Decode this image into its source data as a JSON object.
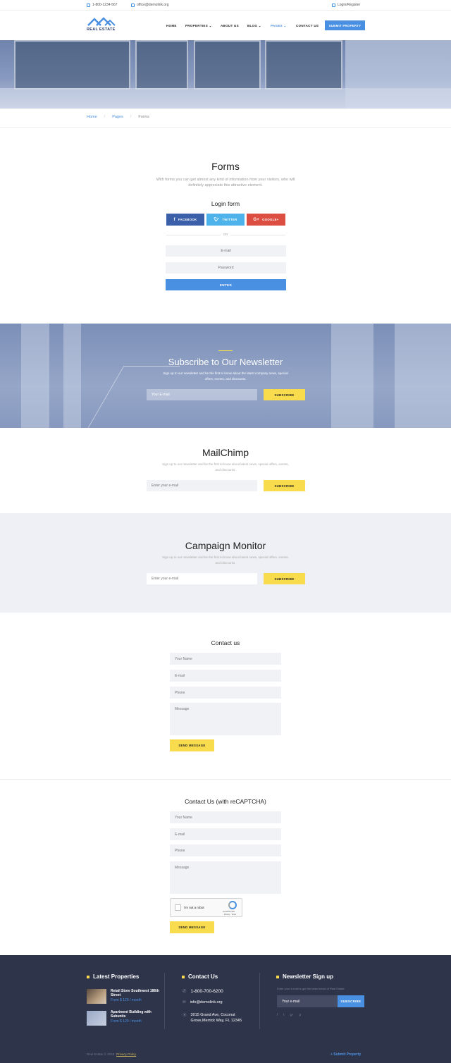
{
  "topbar": {
    "phone": "1-800-1234-567",
    "email": "office@demolink.org",
    "login": "Login/Register"
  },
  "header": {
    "logo_text": "REAL ESTATE",
    "nav": [
      "HOME",
      "PROPERTIES",
      "ABOUT US",
      "BLOG",
      "PAGES",
      "CONTACT US"
    ],
    "active_nav": "PAGES",
    "submit_button": "SUBMIT PROPERTY"
  },
  "hero": {
    "title": "Forms"
  },
  "breadcrumb": [
    "Home",
    "Pages",
    "Forms"
  ],
  "forms_section": {
    "title": "Forms",
    "description": "With forms you can get almost any kind of information from your visitors, who will definitely appreciate this attractive element.",
    "login_title": "Login form",
    "social": [
      "FACEBOOK",
      "TWITTER",
      "GOOGLE+"
    ],
    "or_label": "OR",
    "email_placeholder": "E-mail",
    "password_placeholder": "Password",
    "enter_button": "ENTER"
  },
  "newsletter": {
    "title": "Subscribe to Our Newsletter",
    "description": "Sign up to our newsletter and be the first to know about the latest company news, special offers, events, and discounts.",
    "email_placeholder": "Your E-mail",
    "button": "SUBSCRIBE"
  },
  "mailchimp": {
    "title": "MailChimp",
    "description": "Sign up to our newsletter and be the first to know about latest news, special offers, events, and discounts.",
    "email_placeholder": "Enter your e-mail",
    "button": "SUBSCRIBE"
  },
  "campaign": {
    "title": "Campaign Monitor",
    "description": "Sign up to our newsletter and be the first to know about latest news, special offers, events, and discounts.",
    "email_placeholder": "Enter your e-mail",
    "button": "SUBSCRIBE"
  },
  "contact": {
    "title": "Contact us",
    "name_placeholder": "Your Name",
    "email_placeholder": "E-mail",
    "phone_placeholder": "Phone",
    "message_placeholder": "Message",
    "button": "SEND MESSAGE"
  },
  "contact_recaptcha": {
    "title": "Contact Us (with reCAPTCHA)",
    "name_placeholder": "Your Name",
    "email_placeholder": "E-mail",
    "phone_placeholder": "Phone",
    "message_placeholder": "Message",
    "captcha_label": "I'm not a robot",
    "captcha_brand": "reCAPTCHA",
    "captcha_links": "Privacy - Terms",
    "button": "SEND MESSAGE"
  },
  "footer": {
    "latest_title": "Latest Properties",
    "properties": [
      {
        "name": "Retail Store Southwest 186th Street",
        "price": "From $ 120 / month"
      },
      {
        "name": "Apartment Building with Subunits",
        "price": "From $ 120 / month"
      }
    ],
    "contact_title": "Contact Us",
    "phone": "1-800-700-6200",
    "email": "info@demolink.org",
    "address": "3015 Grand Ave, Coconut Grove,Merrick Way, FL 12345",
    "newsletter_title": "Newsletter Sign up",
    "newsletter_text": "Enter your e-mail to get the latest news of Real Estate.",
    "newsletter_placeholder": "Your e-mail",
    "newsletter_button": "SUBSCRIBE",
    "social_icons": [
      "f",
      "t",
      "g+",
      "p"
    ],
    "copyright": "Real Estate © 2018",
    "privacy": "Privacy Policy",
    "submit_link": "+ Submit Property"
  },
  "colors": {
    "primary": "#4a90e2",
    "accent": "#f8dc4e",
    "footer": "#2e344a",
    "facebook": "#3b5fa8",
    "twitter": "#4db3ea",
    "google": "#dc4e41"
  }
}
